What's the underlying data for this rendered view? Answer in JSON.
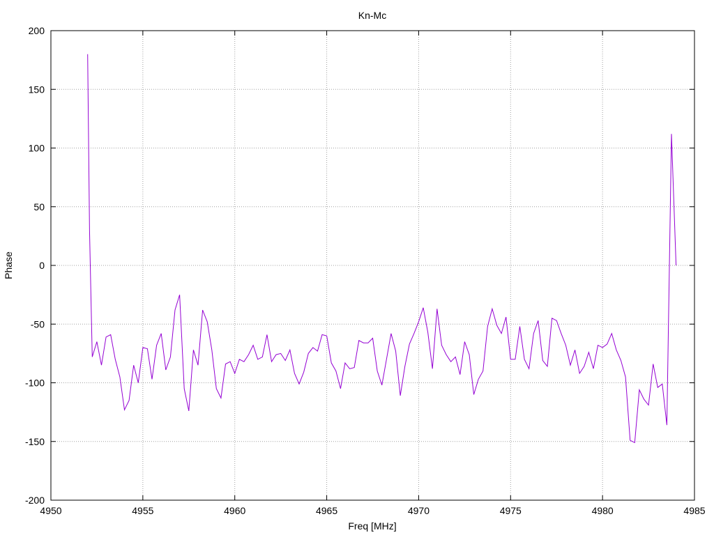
{
  "chart_data": {
    "type": "line",
    "title": "Kn-Mc",
    "xlabel": "Freq [MHz]",
    "ylabel": "Phase",
    "xlim": [
      4950,
      4985
    ],
    "ylim": [
      -200,
      200
    ],
    "xticks": [
      4950,
      4955,
      4960,
      4965,
      4970,
      4975,
      4980,
      4985
    ],
    "yticks": [
      -200,
      -150,
      -100,
      -50,
      0,
      50,
      100,
      150,
      200
    ],
    "grid": true,
    "series": [
      {
        "color": "#9400d3",
        "x": [
          4952.0,
          4952.1,
          4952.25,
          4952.5,
          4952.75,
          4953.0,
          4953.25,
          4953.5,
          4953.75,
          4954.0,
          4954.25,
          4954.5,
          4954.75,
          4955.0,
          4955.25,
          4955.5,
          4955.75,
          4956.0,
          4956.25,
          4956.5,
          4956.75,
          4957.0,
          4957.25,
          4957.5,
          4957.75,
          4958.0,
          4958.25,
          4958.5,
          4958.75,
          4959.0,
          4959.25,
          4959.5,
          4959.75,
          4960.0,
          4960.25,
          4960.5,
          4960.75,
          4961.0,
          4961.25,
          4961.5,
          4961.75,
          4962.0,
          4962.25,
          4962.5,
          4962.75,
          4963.0,
          4963.25,
          4963.5,
          4963.75,
          4964.0,
          4964.25,
          4964.5,
          4964.75,
          4965.0,
          4965.25,
          4965.5,
          4965.75,
          4966.0,
          4966.25,
          4966.5,
          4966.75,
          4967.0,
          4967.25,
          4967.5,
          4967.75,
          4968.0,
          4968.25,
          4968.5,
          4968.75,
          4969.0,
          4969.25,
          4969.5,
          4969.75,
          4970.0,
          4970.25,
          4970.5,
          4970.75,
          4971.0,
          4971.25,
          4971.5,
          4971.75,
          4972.0,
          4972.25,
          4972.5,
          4972.75,
          4973.0,
          4973.25,
          4973.5,
          4973.75,
          4974.0,
          4974.25,
          4974.5,
          4974.75,
          4975.0,
          4975.25,
          4975.5,
          4975.75,
          4976.0,
          4976.25,
          4976.5,
          4976.75,
          4977.0,
          4977.25,
          4977.5,
          4977.75,
          4978.0,
          4978.25,
          4978.5,
          4978.75,
          4979.0,
          4979.25,
          4979.5,
          4979.75,
          4980.0,
          4980.25,
          4980.5,
          4980.75,
          4981.0,
          4981.25,
          4981.5,
          4981.75,
          4982.0,
          4982.25,
          4982.5,
          4982.75,
          4983.0,
          4983.25,
          4983.5,
          4983.75,
          4984.0
        ],
        "y": [
          180,
          30,
          -78,
          -65,
          -85,
          -61,
          -59,
          -80,
          -95,
          -123,
          -115,
          -85,
          -100,
          -70,
          -71,
          -97,
          -68,
          -58,
          -89,
          -78,
          -38,
          -25,
          -105,
          -124,
          -72,
          -85,
          -38,
          -48,
          -72,
          -105,
          -113,
          -84,
          -82,
          -92,
          -80,
          -82,
          -76,
          -68,
          -80,
          -78,
          -59,
          -82,
          -76,
          -75,
          -81,
          -72,
          -92,
          -101,
          -91,
          -75,
          -70,
          -73,
          -59,
          -60,
          -83,
          -90,
          -105,
          -83,
          -88,
          -87,
          -64,
          -66,
          -66,
          -62,
          -90,
          -102,
          -80,
          -58,
          -73,
          -111,
          -86,
          -67,
          -58,
          -48,
          -36,
          -57,
          -88,
          -37,
          -68,
          -76,
          -82,
          -78,
          -93,
          -65,
          -76,
          -110,
          -97,
          -90,
          -52,
          -37,
          -51,
          -58,
          -44,
          -80,
          -80,
          -52,
          -80,
          -88,
          -58,
          -47,
          -81,
          -86,
          -45,
          -47,
          -58,
          -68,
          -85,
          -72,
          -92,
          -86,
          -74,
          -88,
          -68,
          -70,
          -67,
          -58,
          -72,
          -81,
          -95,
          -149,
          -151,
          -106,
          -114,
          -119,
          -84,
          -104,
          -101,
          -136,
          112,
          0
        ]
      }
    ]
  }
}
